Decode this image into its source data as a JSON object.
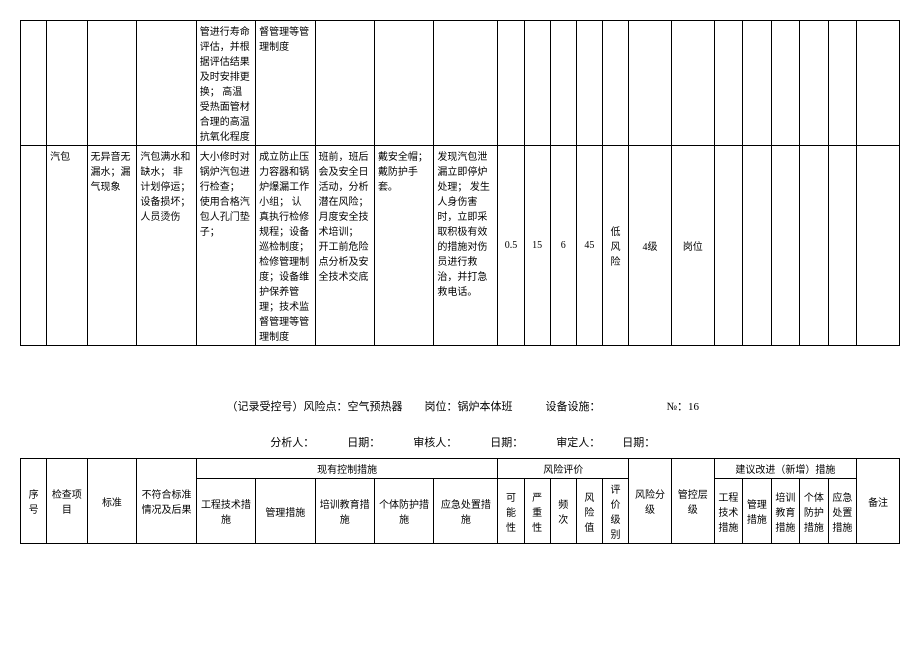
{
  "table1": {
    "row1": {
      "c4": "管进行寿命评估，并根据评估结果及时安排更换；\n高温受热面管材合理的高温抗氧化程度",
      "c5": "督管理等管理制度"
    },
    "row2": {
      "c1": "汽包",
      "c2": "无异音无漏水；漏气现象",
      "c3": "汽包满水和缺水；\n非计划停运；\n设备损坏；人员烫伤",
      "c4": "大小修时对锅炉汽包进行检查；\n使用合格汽包人孔门垫子；",
      "c5": "成立防止压力容器和锅炉爆漏工作小组；\n认真执行检修规程；设备巡检制度；检修管理制度；设备维护保养管理；技术监督管理等管理制度",
      "c6": "班前，班后会及安全日活动，分析潜在风险；\n月度安全技术培训；\n开工前危险点分析及安全技术交底",
      "c7": "戴安全帽；戴防护手套。",
      "c8": "发现汽包泄漏立即停炉处理；\n发生人身伤害时，立即采取积极有效的措施对伤员进行救治，并打急救电话。",
      "c9": "0.5",
      "c10": "15",
      "c11": "6",
      "c12": "45",
      "c13": "低风险",
      "c14": "4级",
      "c15": "岗位"
    }
  },
  "meta": {
    "line1_prefix": "（记录受控号）风险点：空气预热器",
    "line1_post": "岗位：锅炉本体班",
    "line1_dev": "设备设施：",
    "line1_no": "№：16",
    "line2_analyst": "分析人：",
    "line2_date1": "日期：",
    "line2_reviewer": "审核人：",
    "line2_date2": "日期：",
    "line2_approver": "审定人：",
    "line2_date3": "日期："
  },
  "table2": {
    "h_seq": "序号",
    "h_item": "检查项目",
    "h_std": "标准",
    "h_nonstd": "不符合标准情况及后果",
    "h_current": "现有控制措施",
    "h_eng": "工程技术措施",
    "h_mgmt": "管理措施",
    "h_train": "培训教育措施",
    "h_ppe": "个体防护措施",
    "h_emerg": "应急处置措施",
    "h_risk": "风险评价",
    "h_poss": "可能性",
    "h_sev": "严重性",
    "h_freq": "频次",
    "h_val": "风险值",
    "h_lvl": "评价级别",
    "h_grade": "风险分级",
    "h_ctrl": "管控层级",
    "h_suggest": "建议改进（新增）措施",
    "h_s_eng": "工程技术措施",
    "h_s_mgmt": "管理措施",
    "h_s_train": "培训教育措施",
    "h_s_ppe": "个体防护措施",
    "h_s_emerg": "应急处置措施",
    "h_remark": "备注"
  }
}
